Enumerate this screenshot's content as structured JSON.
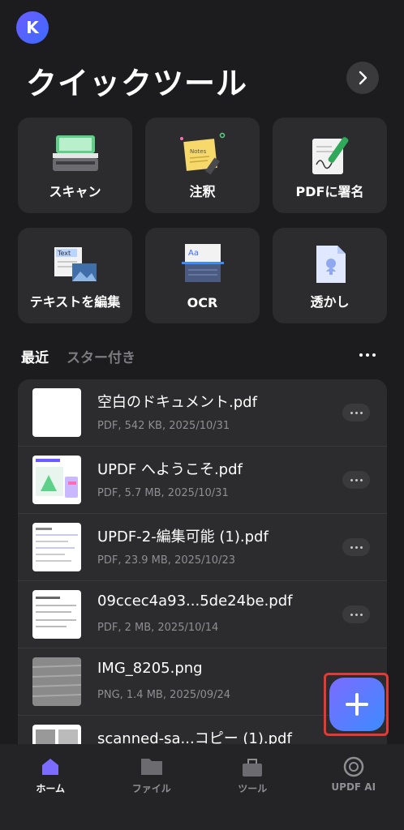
{
  "header": {
    "avatar_letter": "K",
    "title": "クイックツール"
  },
  "tools": [
    {
      "label": "スキャン",
      "icon": "scanner-icon"
    },
    {
      "label": "注釈",
      "icon": "notes-icon"
    },
    {
      "label": "PDFに署名",
      "icon": "signature-icon"
    },
    {
      "label": "テキストを編集",
      "icon": "edit-text-icon"
    },
    {
      "label": "OCR",
      "icon": "ocr-icon"
    },
    {
      "label": "透かし",
      "icon": "watermark-icon"
    }
  ],
  "tabs": {
    "recent": "最近",
    "starred": "スター付き"
  },
  "files": [
    {
      "name": "空白のドキュメント.pdf",
      "meta": "PDF, 542 KB, 2025/10/31"
    },
    {
      "name": "UPDF へようこそ.pdf",
      "meta": "PDF, 5.7 MB, 2025/10/31"
    },
    {
      "name": "UPDF-2-編集可能 (1).pdf",
      "meta": "PDF, 23.9 MB, 2025/10/23"
    },
    {
      "name": "09ccec4a93...5de24be.pdf",
      "meta": "PDF, 2 MB, 2025/10/14"
    },
    {
      "name": "IMG_8205.png",
      "meta": "PNG, 1.4 MB, 2025/09/24"
    },
    {
      "name": "scanned-sa...コピー (1).pdf",
      "meta": ""
    }
  ],
  "nav": [
    {
      "label": "ホーム",
      "icon": "home-icon",
      "active": true
    },
    {
      "label": "ファイル",
      "icon": "folder-icon",
      "active": false
    },
    {
      "label": "ツール",
      "icon": "toolbox-icon",
      "active": false
    },
    {
      "label": "UPDF AI",
      "icon": "ai-icon",
      "active": false
    }
  ],
  "colors": {
    "accent": "#6a5cff",
    "background": "#1c1c1e",
    "card": "#2c2c2e",
    "highlight": "#e53935"
  }
}
